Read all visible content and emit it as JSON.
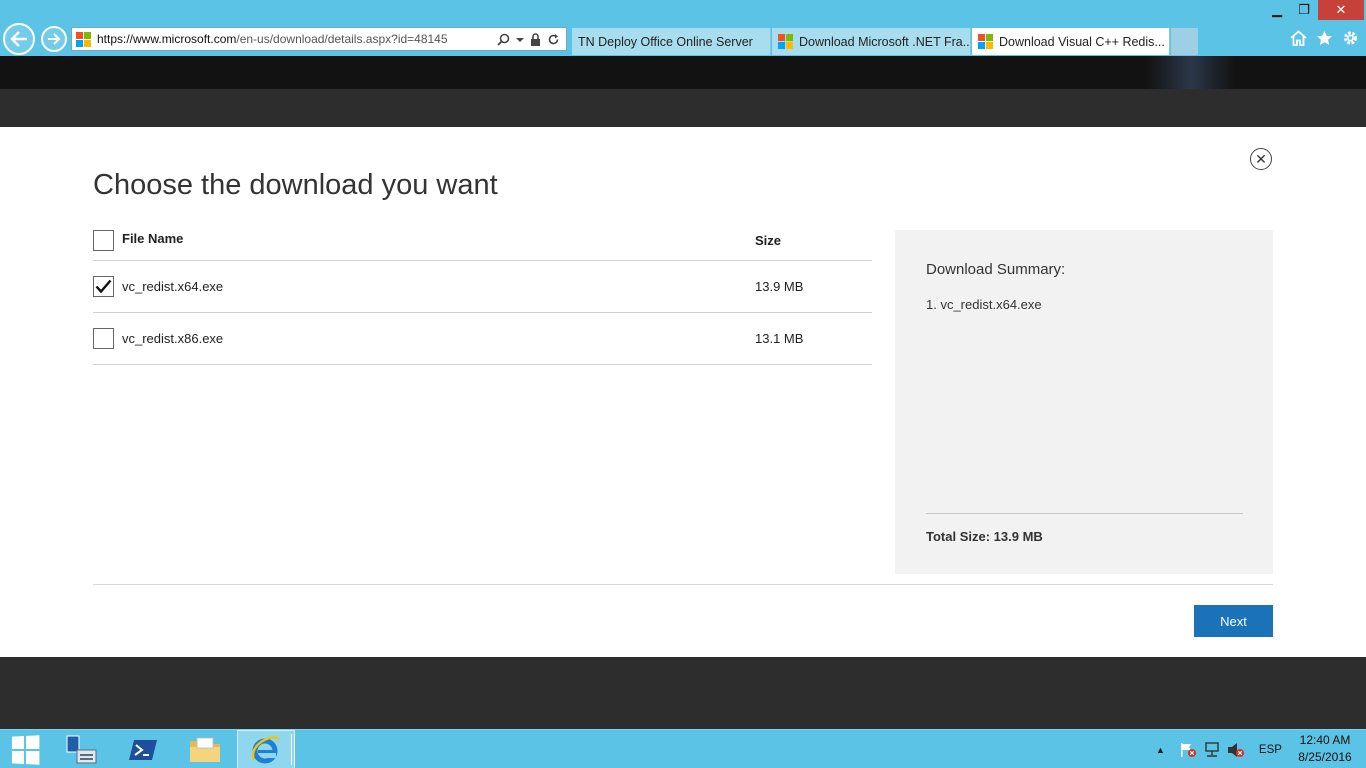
{
  "browser": {
    "url_host": "https://www.microsoft.com",
    "url_rest": "/en-us/download/details.aspx?id=48145",
    "tabs": [
      {
        "label": "TN Deploy Office Online Server"
      },
      {
        "label": "Download Microsoft .NET Fra..."
      },
      {
        "label": "Download Visual C++ Redis..."
      }
    ],
    "tab_close": "✕",
    "window": {
      "minimize": "▁",
      "maximize": "❐",
      "close": "✕"
    }
  },
  "dialog": {
    "title": "Choose the download you want",
    "close_glyph": "✕",
    "table": {
      "col_name": "File Name",
      "col_size": "Size",
      "rows": [
        {
          "name": "vc_redist.x64.exe",
          "size": "13.9 MB",
          "checked": true
        },
        {
          "name": "vc_redist.x86.exe",
          "size": "13.1 MB",
          "checked": false
        }
      ]
    },
    "summary": {
      "title": "Download Summary:",
      "item": "1. vc_redist.x64.exe",
      "total": "Total Size: 13.9 MB"
    },
    "next_label": "Next"
  },
  "taskbar": {
    "language": "ESP",
    "time": "12:40 AM",
    "date": "8/25/2016",
    "tray_arrow": "▲"
  },
  "colors": {
    "chrome": "#5bc3e5",
    "accent_button": "#1a73b8",
    "close_button": "#c7413a"
  }
}
